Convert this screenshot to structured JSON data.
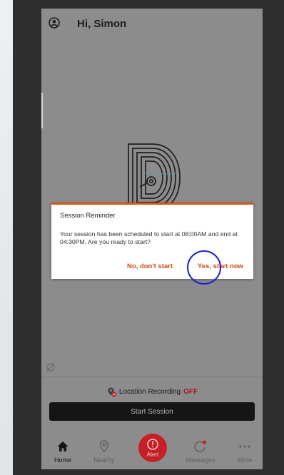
{
  "header": {
    "greeting": "Hi, Simon"
  },
  "dialog": {
    "title": "Session Reminder",
    "body": "Your session has been scheduled to start at 08:00AM and end at 04:30PM. Are you ready to start?",
    "decline_label": "No, don't start",
    "accept_label": "Yes, start now"
  },
  "location": {
    "label": "Location Recording",
    "status": "OFF"
  },
  "start_button": {
    "label": "Start Session"
  },
  "tabs": [
    {
      "label": "Home",
      "icon": "home-icon",
      "active": true
    },
    {
      "label": "Nearby",
      "icon": "location-pin-icon"
    },
    {
      "label": "Alert",
      "icon": "alert-icon"
    },
    {
      "label": "Messages",
      "icon": "messages-icon"
    },
    {
      "label": "More",
      "icon": "more-icon"
    }
  ],
  "colors": {
    "accent": "#c94b13",
    "alert": "#c5202a",
    "status_off": "#a61616",
    "dim_overlay": "#8c8c8c",
    "highlight_circle": "#1f1fcf"
  }
}
